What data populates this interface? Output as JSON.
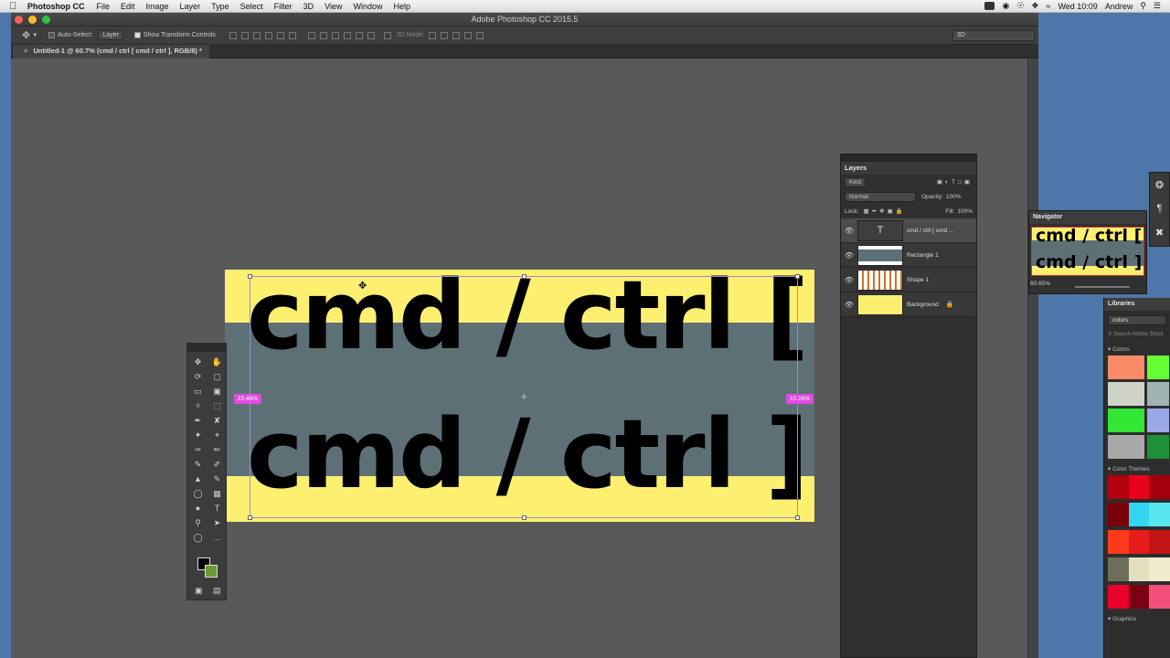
{
  "menubar": {
    "app": "Photoshop CC",
    "items": [
      "File",
      "Edit",
      "Image",
      "Layer",
      "Type",
      "Select",
      "Filter",
      "3D",
      "View",
      "Window",
      "Help"
    ],
    "clock": "Wed 10:09",
    "user": "Andrew"
  },
  "window": {
    "title": "Adobe Photoshop CC 2015.5",
    "doc_tab": "Untitled-1 @ 60.7% (cmd / ctrl [ cmd / ctrl ], RGB/8) *"
  },
  "options": {
    "auto_select_label": "Auto-Select:",
    "auto_select_value": "Layer",
    "show_transform_label": "Show Transform Controls",
    "mode_3d_label": "3D Mode:",
    "workspace_value": "3D"
  },
  "canvas": {
    "line1": "cmd / ctrl [",
    "line2": "cmd / ctrl ]",
    "left_pct": "22.48%",
    "right_pct": "10.26%",
    "colors": {
      "yellow": "#fdf071",
      "teal": "#5d7076"
    }
  },
  "layers": {
    "title": "Layers",
    "kind_label": "Kind",
    "blend_mode": "Normal",
    "opacity_label": "Opacity:",
    "opacity_value": "100%",
    "lock_label": "Lock:",
    "fill_label": "Fill:",
    "fill_value": "100%",
    "items": [
      {
        "name": "cmd / ctrl [ cmd ...",
        "thumb": "T"
      },
      {
        "name": "Rectangle 1"
      },
      {
        "name": "Shape 1"
      },
      {
        "name": "Background"
      }
    ]
  },
  "navigator": {
    "title": "Navigator",
    "line1": "cmd / ctrl [",
    "line2": "cmd / ctrl ]",
    "zoom": "60.65%"
  },
  "libraries": {
    "title": "Libraries",
    "library": "colors",
    "search_placeholder": "Search Adobe Stock",
    "colors_label": "Colors",
    "themes_label": "Color Themes",
    "graphics_label": "Graphics",
    "swatches": [
      "#f98b66",
      "#66ff33",
      "#d0d3c8",
      "#a0b4b4",
      "#33e633",
      "#9aa8e6",
      "#a8a8a8",
      "#1f8f3a"
    ],
    "themes": [
      [
        "#b3000f",
        "#e8001a",
        "#a3000c"
      ],
      [
        "#7a000a",
        "#33d6f0",
        "#5be6ef"
      ],
      [
        "#ff3a1a",
        "#e61c1c",
        "#c21616"
      ],
      [
        "#6e6e5a",
        "#e6dfbf",
        "#f2ecce"
      ],
      [
        "#e8002a",
        "#7a0011",
        "#f24f7a"
      ]
    ]
  }
}
